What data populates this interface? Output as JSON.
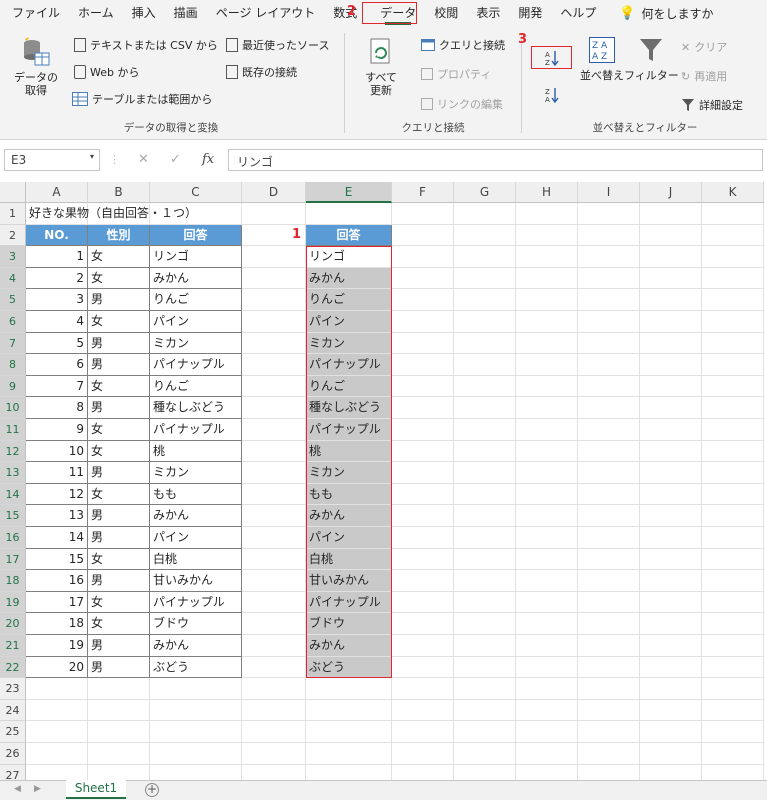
{
  "tabs": [
    "ファイル",
    "ホーム",
    "挿入",
    "描画",
    "ページ レイアウト",
    "数式",
    "データ",
    "校閲",
    "表示",
    "開発",
    "ヘルプ"
  ],
  "tell_me": "何をしますか",
  "ribbon": {
    "get_data": "データの\n取得",
    "text_csv": "テキストまたは CSV から",
    "web": "Web から",
    "range": "テーブルまたは範囲から",
    "recent": "最近使ったソース",
    "existing": "既存の接続",
    "group1_label": "データの取得と変換",
    "refresh_all": "すべて\n更新",
    "queries": "クエリと接続",
    "properties": "プロパティ",
    "edit_links": "リンクの編集",
    "group2_label": "クエリと接続",
    "sort": "並べ替え",
    "filter": "フィルター",
    "clear": "クリア",
    "reapply": "再適用",
    "advanced": "詳細設定",
    "group3_label": "並べ替えとフィルター"
  },
  "annotations": [
    "1",
    "2",
    "3"
  ],
  "formula": {
    "namebox": "E3",
    "fx": "fx",
    "content": "リンゴ"
  },
  "columns": [
    "A",
    "B",
    "C",
    "D",
    "E",
    "F",
    "G",
    "H",
    "I",
    "J",
    "K"
  ],
  "title": "好きな果物（自由回答・１つ）",
  "table_headers": [
    "NO.",
    "性別",
    "回答"
  ],
  "e_header": "回答",
  "rows": [
    [
      1,
      "女",
      "リンゴ"
    ],
    [
      2,
      "女",
      "みかん"
    ],
    [
      3,
      "男",
      "りんご"
    ],
    [
      4,
      "女",
      "パイン"
    ],
    [
      5,
      "男",
      "ミカン"
    ],
    [
      6,
      "男",
      "パイナップル"
    ],
    [
      7,
      "女",
      "りんご"
    ],
    [
      8,
      "男",
      "種なしぶどう"
    ],
    [
      9,
      "女",
      "パイナップル"
    ],
    [
      10,
      "女",
      "桃"
    ],
    [
      11,
      "男",
      "ミカン"
    ],
    [
      12,
      "女",
      "もも"
    ],
    [
      13,
      "男",
      "みかん"
    ],
    [
      14,
      "男",
      "パイン"
    ],
    [
      15,
      "女",
      "白桃"
    ],
    [
      16,
      "男",
      "甘いみかん"
    ],
    [
      17,
      "女",
      "パイナップル"
    ],
    [
      18,
      "女",
      "ブドウ"
    ],
    [
      19,
      "男",
      "みかん"
    ],
    [
      20,
      "男",
      "ぶどう"
    ]
  ],
  "e_values": [
    "リンゴ",
    "みかん",
    "りんご",
    "パイン",
    "ミカン",
    "パイナップル",
    "りんご",
    "種なしぶどう",
    "パイナップル",
    "桃",
    "ミカン",
    "もも",
    "みかん",
    "パイン",
    "白桃",
    "甘いみかん",
    "パイナップル",
    "ブドウ",
    "みかん",
    "ぶどう"
  ],
  "row_count": 27,
  "sheet_name": "Sheet1"
}
